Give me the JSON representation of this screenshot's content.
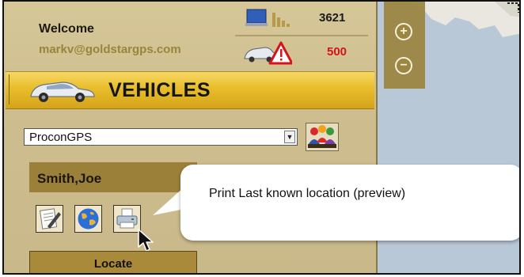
{
  "header": {
    "welcome": "Welcome",
    "email": "markv@goldstargps.com",
    "count_primary": "3621",
    "count_alerts": "500"
  },
  "section": {
    "title": "VEHICLES"
  },
  "group_select": {
    "selected": "ProconGPS"
  },
  "driver": {
    "name": "Smith,Joe"
  },
  "actions": {
    "locate_label": "Locate",
    "tooltip": "Print Last known location (preview)"
  },
  "map": {
    "zoom_in": "+",
    "zoom_out": "−"
  },
  "colors": {
    "gold_bar": "#e8bd2a",
    "alert_red": "#d3141b",
    "email_gold": "#9a8538"
  }
}
